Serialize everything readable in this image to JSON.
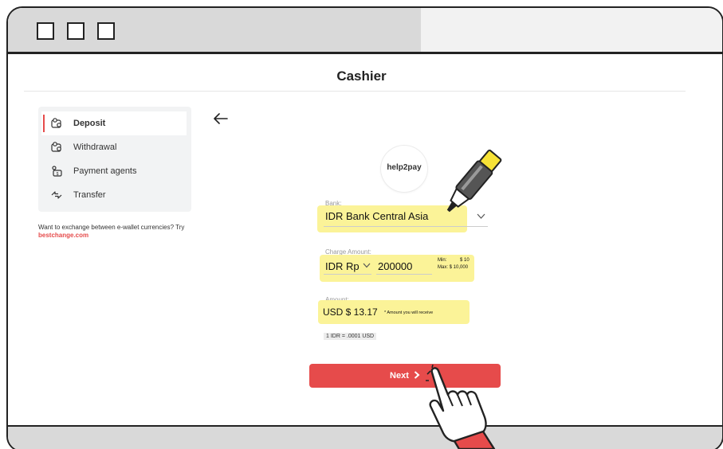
{
  "header": {
    "title": "Cashier"
  },
  "sidebar": {
    "items": [
      {
        "label": "Deposit",
        "icon": "wallet-in-icon",
        "active": true
      },
      {
        "label": "Withdrawal",
        "icon": "wallet-out-icon",
        "active": false
      },
      {
        "label": "Payment agents",
        "icon": "agent-icon",
        "active": false
      },
      {
        "label": "Transfer",
        "icon": "transfer-icon",
        "active": false
      }
    ],
    "help_text": "Want to exchange between e-wallet currencies? Try ",
    "help_link": "bestchange.com"
  },
  "form": {
    "logo_text": "help2pay",
    "bank_label": "Bank:",
    "bank_value": "IDR Bank Central Asia",
    "charge_label": "Charge Amount:",
    "charge_currency": "IDR Rp",
    "charge_value": "200000",
    "min_label": "Min:",
    "min_value": "$ 10",
    "max_label": "Max: $ 10,000",
    "amount_label": "Amount:",
    "amount_value": "USD $ 13.17",
    "amount_note": "* Amount you will receive",
    "rate": "1 IDR = .0001 USD",
    "next_label": "Next"
  },
  "colors": {
    "accent": "#e64b4b",
    "highlight": "#fbf398",
    "sidebar_bg": "#f2f3f4"
  }
}
